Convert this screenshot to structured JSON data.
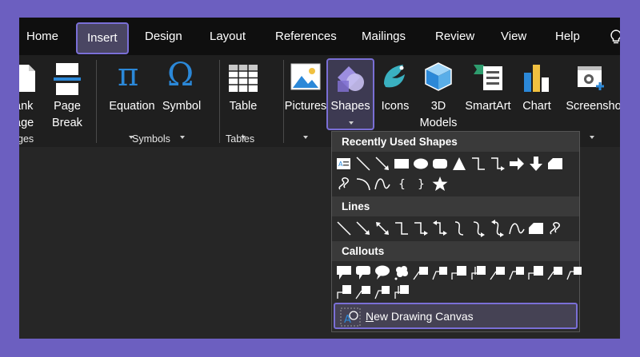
{
  "tabs": [
    {
      "label": "Home"
    },
    {
      "label": "Insert",
      "selected": true
    },
    {
      "label": "Design"
    },
    {
      "label": "Layout"
    },
    {
      "label": "References"
    },
    {
      "label": "Mailings"
    },
    {
      "label": "Review"
    },
    {
      "label": "View"
    },
    {
      "label": "Help"
    }
  ],
  "ribbon": {
    "pages_group": {
      "blank_page": {
        "line1": "ank",
        "line2": "age"
      },
      "page_break": {
        "line1": "Page",
        "line2": "Break"
      },
      "label": "ges"
    },
    "symbols_group": {
      "equation": "Equation",
      "symbol": "Symbol",
      "label": "Symbols"
    },
    "tables_group": {
      "table": "Table",
      "label": "Tables"
    },
    "illustrations": {
      "pictures": "Pictures",
      "shapes": "Shapes",
      "icons": "Icons",
      "models": {
        "line1": "3D",
        "line2": "Models"
      },
      "smartart": "SmartArt",
      "chart": "Chart",
      "screenshot": "Screenshot"
    }
  },
  "dropdown": {
    "recent_header": "Recently Used Shapes",
    "lines_header": "Lines",
    "callouts_header": "Callouts",
    "new_canvas": "New Drawing Canvas"
  },
  "colors": {
    "accent": "#7a6fd6",
    "background": "#6c5fc0",
    "ribbon": "#1f1f1f",
    "icon_blue": "#2b88d8",
    "icon_teal": "#3ab0c0"
  }
}
